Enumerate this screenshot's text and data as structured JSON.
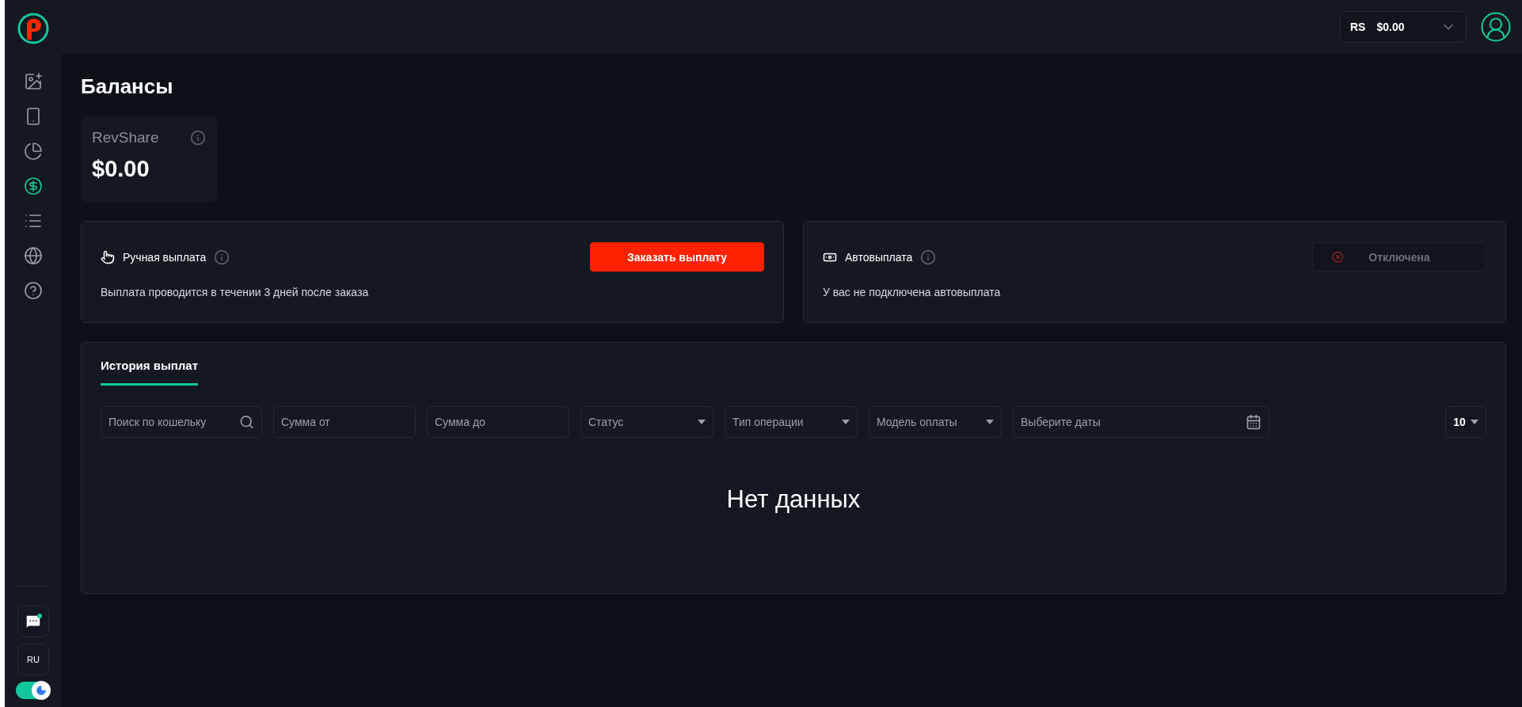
{
  "sidebar": {
    "items": [
      {
        "kind": "add-image",
        "selected": false
      },
      {
        "kind": "phone",
        "selected": false
      },
      {
        "kind": "pie",
        "selected": false
      },
      {
        "kind": "dollar",
        "selected": true
      },
      {
        "kind": "list",
        "selected": false
      },
      {
        "kind": "news",
        "selected": false
      },
      {
        "kind": "help",
        "selected": false
      }
    ],
    "chat": {
      "unread": true
    },
    "language": "RU",
    "dark_mode": true
  },
  "header": {
    "currency": "RS",
    "balance": "$0.00"
  },
  "page_title": "Балансы",
  "balance_cards": [
    {
      "label": "RevShare",
      "amount": "$0.00"
    }
  ],
  "payout_cards": [
    {
      "kind": "manual",
      "title": "Ручная выплата",
      "description": "Выплата проводится в течении 3 дней после заказа",
      "action": {
        "label": "Заказать выплату",
        "disabled": false
      }
    },
    {
      "kind": "auto",
      "title": "Автовыплата",
      "description": "У вас не подключена автовыплата",
      "action": {
        "label": "Отключена",
        "disabled": true
      }
    }
  ],
  "history": {
    "tabs": [
      {
        "label": "История выплат",
        "selected": true
      }
    ],
    "filters": [
      {
        "kind": "search",
        "placeholder": "Поиск по кошельку"
      },
      {
        "kind": "text",
        "placeholder": "Сумма от"
      },
      {
        "kind": "text",
        "placeholder": "Сумма до"
      },
      {
        "kind": "select",
        "placeholder": "Статус"
      },
      {
        "kind": "select",
        "placeholder": "Тип операции"
      },
      {
        "kind": "select",
        "placeholder": "Модель оплаты"
      },
      {
        "kind": "date",
        "placeholder": "Выберите даты"
      }
    ],
    "page_size": "10",
    "empty_text": "Нет данных"
  }
}
